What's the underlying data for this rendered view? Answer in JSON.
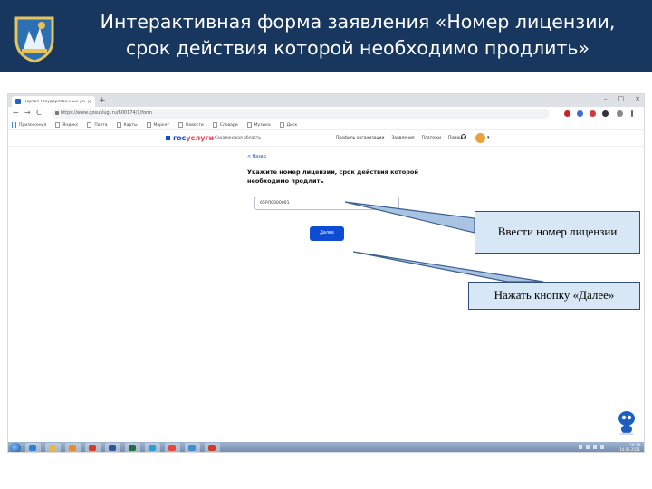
{
  "slide": {
    "title_line1": "Интерактивная форма заявления «Номер лицензии,",
    "title_line2": "срок действия которой необходимо продлить»"
  },
  "browser": {
    "tab_title": "Портал государственных услуг",
    "tab_close": "×",
    "new_tab": "+",
    "url": "https://www.gosuslugi.ru/600174/1/form",
    "nav": {
      "back": "←",
      "forward": "→",
      "reload": "C"
    },
    "bookmarks": [
      "Приложения",
      "Яндекс",
      "Почта",
      "Карты",
      "Маркет",
      "Новости",
      "Словари",
      "Музыка",
      "Диск"
    ],
    "window_controls": [
      "–",
      "□",
      "×"
    ]
  },
  "site": {
    "logo_part1": "гос",
    "logo_part2": "услуги",
    "region": "Сахалинская область",
    "nav_items": [
      "Профиль организации",
      "Заявления",
      "Платежи",
      "Помощь"
    ],
    "back_link": "< Назад",
    "heading": "Укажите номер лицензии, срок действия которой необходимо продлить",
    "license_input_value": "65РЛ0000001",
    "next_button": "Далее"
  },
  "taskbar": {
    "time": "16:28",
    "date": "14.05.2021",
    "apps": [
      {
        "name": "ie",
        "color": "#2f7fd8"
      },
      {
        "name": "explorer",
        "color": "#e8b94a"
      },
      {
        "name": "media",
        "color": "#e98a2b"
      },
      {
        "name": "yandex",
        "color": "#d93b2b"
      },
      {
        "name": "word",
        "color": "#2b5797"
      },
      {
        "name": "excel",
        "color": "#1e7145"
      },
      {
        "name": "skype",
        "color": "#2a9fd6"
      },
      {
        "name": "chrome",
        "color": "#e8453c"
      },
      {
        "name": "network",
        "color": "#3b8fd0"
      },
      {
        "name": "pdf",
        "color": "#cc3b2b"
      }
    ]
  },
  "callouts": {
    "enter_number": "Ввести номер лицензии",
    "press_next": "Нажать кнопку «Далее»"
  },
  "colors": {
    "header_bg": "#17375e",
    "callout_bg": "#d7e7f5",
    "callout_border": "#2f4f78",
    "gosuslugi_blue": "#0d4cd3",
    "gosuslugi_red": "#ee3f58"
  }
}
